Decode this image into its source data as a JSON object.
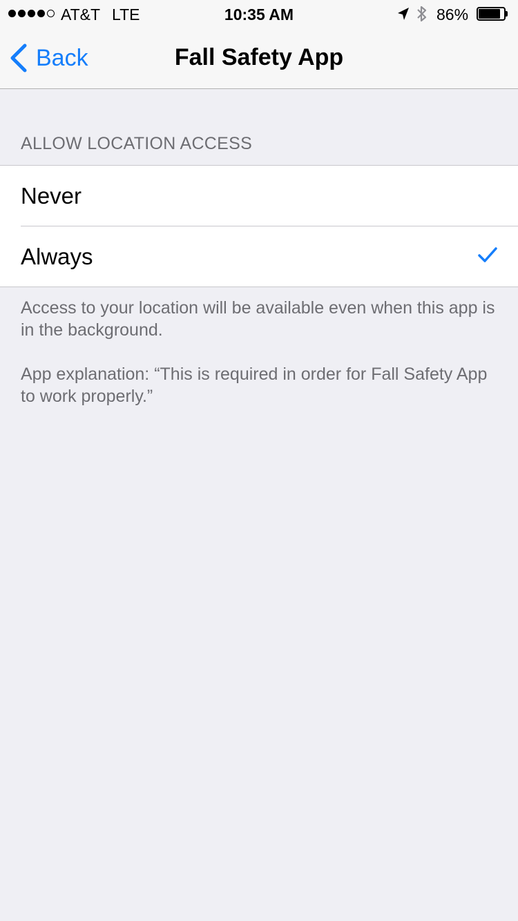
{
  "status_bar": {
    "carrier": "AT&T",
    "network": "LTE",
    "time": "10:35 AM",
    "battery_percent": "86%",
    "battery_level": 0.86,
    "signal_bars_filled": 4,
    "signal_bars_total": 5
  },
  "nav": {
    "back_label": "Back",
    "title": "Fall Safety App"
  },
  "location_access": {
    "header": "ALLOW LOCATION ACCESS",
    "options": [
      {
        "label": "Never",
        "selected": false
      },
      {
        "label": "Always",
        "selected": true
      }
    ],
    "footer_lines": [
      "Access to your location will be available even when this app is in the background.",
      "App explanation: “This is required in order for Fall Safety App to work properly.”"
    ]
  },
  "colors": {
    "accent": "#157efb",
    "background": "#efeff4",
    "secondary_text": "#6d6d72"
  }
}
